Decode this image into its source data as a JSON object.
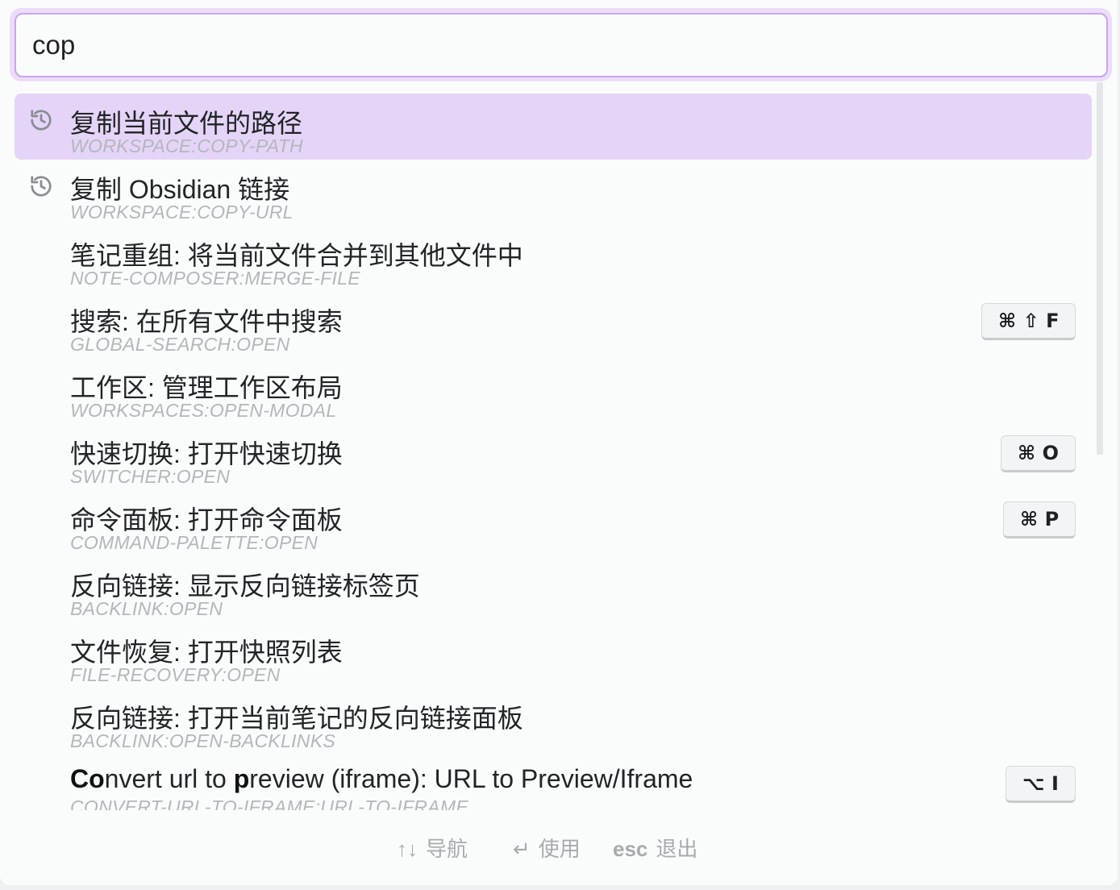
{
  "search": {
    "value": "cop"
  },
  "items": [
    {
      "title": "复制当前文件的路径",
      "command": "workspace:copy-path",
      "icon": "history-icon",
      "hotkey": ""
    },
    {
      "title": "复制 Obsidian 链接",
      "command": "workspace:copy-url",
      "icon": "history-icon",
      "hotkey": ""
    },
    {
      "title": "笔记重组: 将当前文件合并到其他文件中",
      "command": "note-composer:merge-file",
      "icon": "",
      "hotkey": ""
    },
    {
      "title": "搜索: 在所有文件中搜索",
      "command": "global-search:open",
      "icon": "",
      "hotkey": "⌘ ⇧ F"
    },
    {
      "title": "工作区: 管理工作区布局",
      "command": "workspaces:open-modal",
      "icon": "",
      "hotkey": ""
    },
    {
      "title": "快速切换: 打开快速切换",
      "command": "switcher:open",
      "icon": "",
      "hotkey": "⌘ O"
    },
    {
      "title": "命令面板: 打开命令面板",
      "command": "command-palette:open",
      "icon": "",
      "hotkey": "⌘ P"
    },
    {
      "title": "反向链接: 显示反向链接标签页",
      "command": "backlink:open",
      "icon": "",
      "hotkey": ""
    },
    {
      "title": "文件恢复: 打开快照列表",
      "command": "file-recovery:open",
      "icon": "",
      "hotkey": ""
    },
    {
      "title": "反向链接: 打开当前笔记的反向链接面板",
      "command": "backlink:open-backlinks",
      "icon": "",
      "hotkey": ""
    },
    {
      "title_parts": [
        {
          "text": "Co",
          "bold": true
        },
        {
          "text": "nvert url to ",
          "bold": false
        },
        {
          "text": "p",
          "bold": true
        },
        {
          "text": "review (iframe): URL to Preview/Iframe",
          "bold": false
        }
      ],
      "command": "convert-url-to-iframe:url-to-iframe",
      "icon": "",
      "hotkey": "⌥ I"
    }
  ],
  "footer": {
    "nav_keys": "↑↓",
    "nav_label": "导航",
    "use_key": "↵",
    "use_label": "使用",
    "esc_key": "esc",
    "esc_label": "退出"
  },
  "colors": {
    "accent": "#c9a5ee",
    "selected_bg": "#e4d5f8"
  }
}
